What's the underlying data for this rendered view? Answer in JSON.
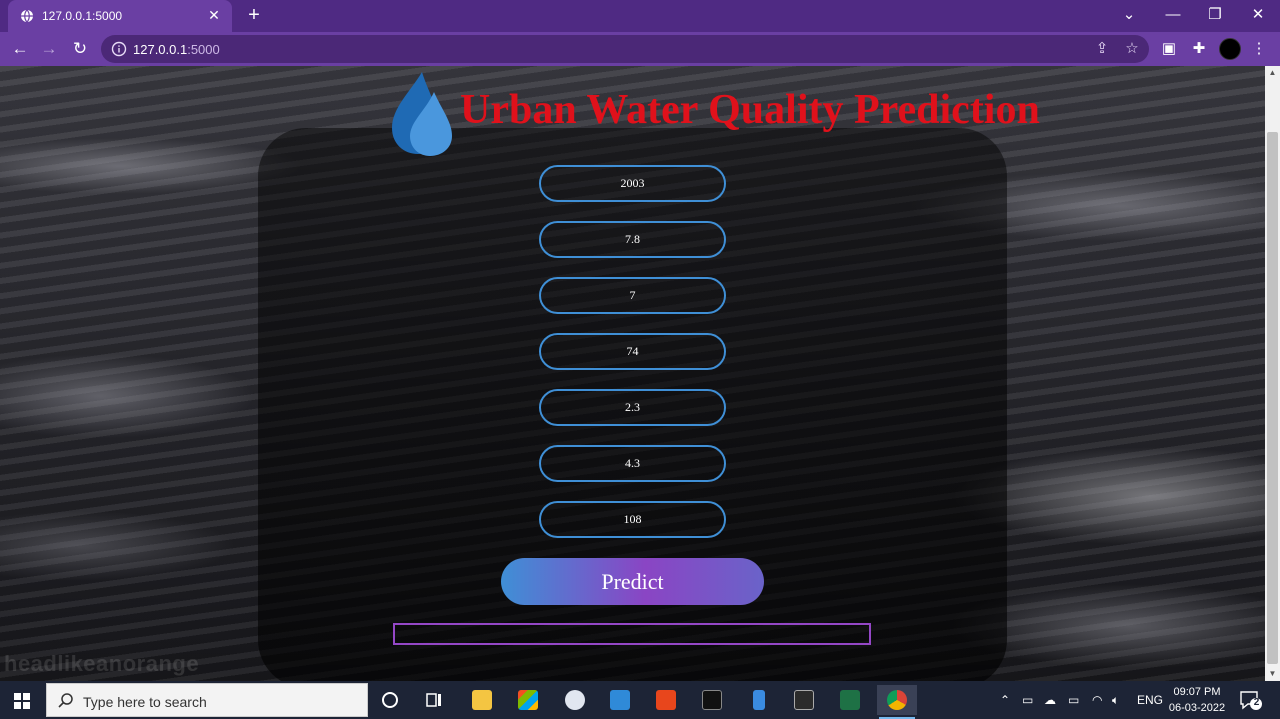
{
  "browser": {
    "tab_title": "127.0.0.1:5000",
    "tab_close": "✕",
    "new_tab": "+",
    "url_host": "127.0.0.1",
    "url_port": ":5000",
    "window": {
      "chevron": "⌄",
      "minimize": "—",
      "restore": "❐",
      "close": "✕"
    }
  },
  "page": {
    "title": "Urban Water Quality Prediction",
    "watermark": "headlikeanorange",
    "fields": [
      "2003",
      "7.8",
      "7",
      "74",
      "2.3",
      "4.3",
      "108"
    ],
    "predict_label": "Predict",
    "result_text": "",
    "colors": {
      "title": "#e0111b",
      "field_border": "#3f8fd6",
      "result_border": "#9447c6"
    }
  },
  "taskbar": {
    "search_placeholder": "Type here to search",
    "lang": "ENG",
    "time": "09:07 PM",
    "date": "06-03-2022",
    "notifications": "2"
  }
}
